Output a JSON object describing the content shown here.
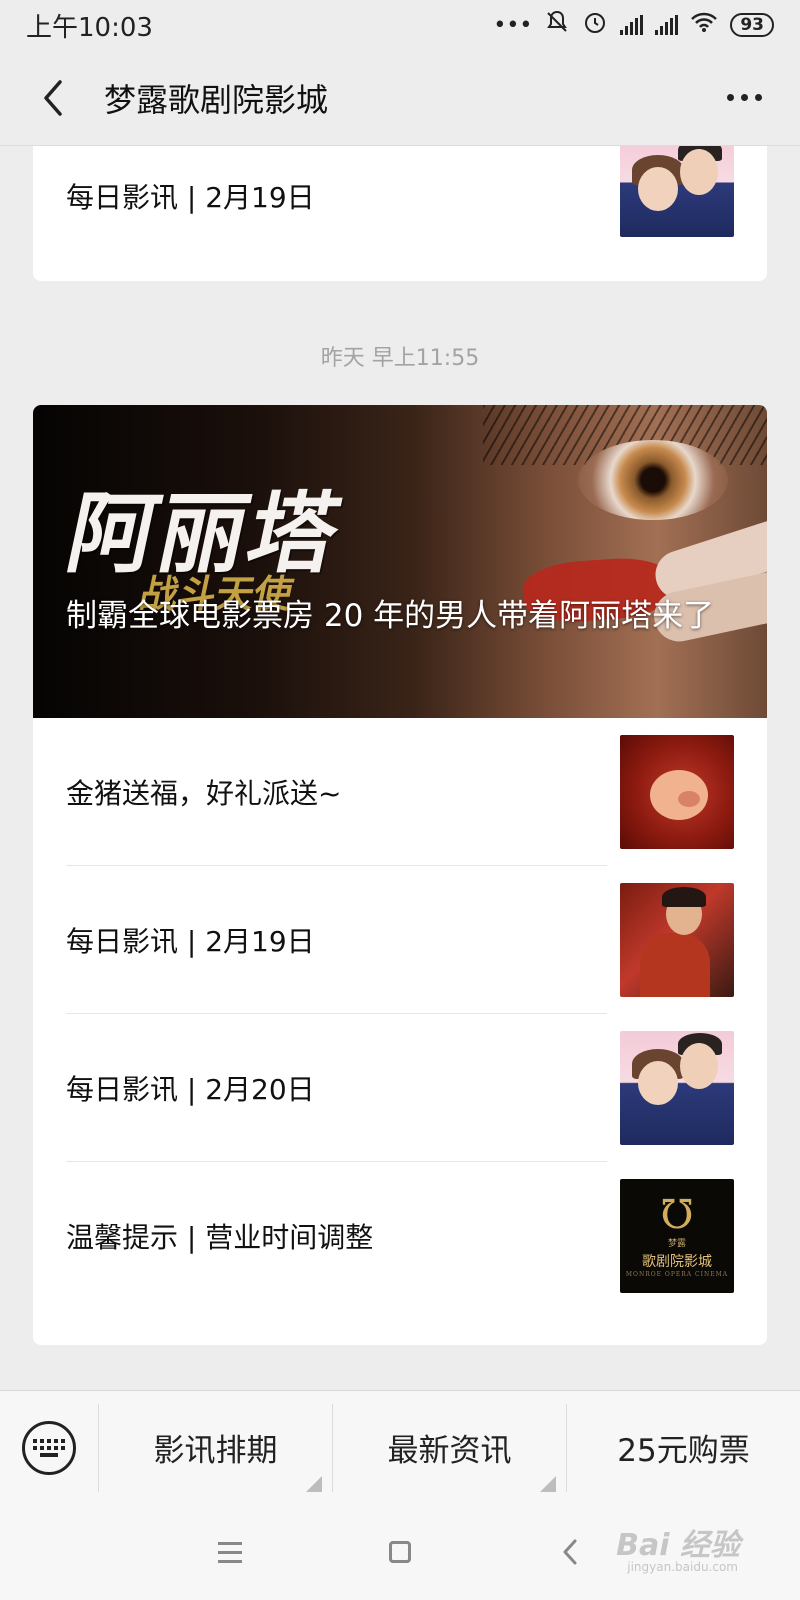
{
  "status_bar": {
    "time": "上午10:03",
    "dots": "•••",
    "battery": "93"
  },
  "nav": {
    "title": "梦露歌剧院影城"
  },
  "top_card": {
    "title": "每日影讯 | 2月19日"
  },
  "timestamp": "昨天 早上11:55",
  "main_card": {
    "hero": {
      "logo_text": "阿丽塔",
      "logo_sub": "战斗天使",
      "title": "制霸全球电影票房 20 年的男人带着阿丽塔来了"
    },
    "items": [
      {
        "title": "金猪送福，好礼派送~"
      },
      {
        "title": "每日影讯 | 2月19日"
      },
      {
        "title": "每日影讯 | 2月20日"
      },
      {
        "title": "温馨提示 | 营业时间调整"
      }
    ],
    "logo_thumb": {
      "small": "梦露",
      "name": "歌剧院影城",
      "sub": "MONROE OPERA CINEMA"
    }
  },
  "bottom_menu": {
    "items": [
      {
        "label": "影讯排期"
      },
      {
        "label": "最新资讯"
      },
      {
        "label": "25元购票"
      }
    ]
  },
  "watermark": {
    "text": "Bai 经验",
    "sub": "jingyan.baidu.com"
  },
  "icons": {
    "back": "back-arrow-icon",
    "more": "more-icon",
    "keyboard": "keyboard-icon",
    "menu": "menu-icon",
    "home": "home-icon",
    "back_nav": "back-nav-icon"
  }
}
